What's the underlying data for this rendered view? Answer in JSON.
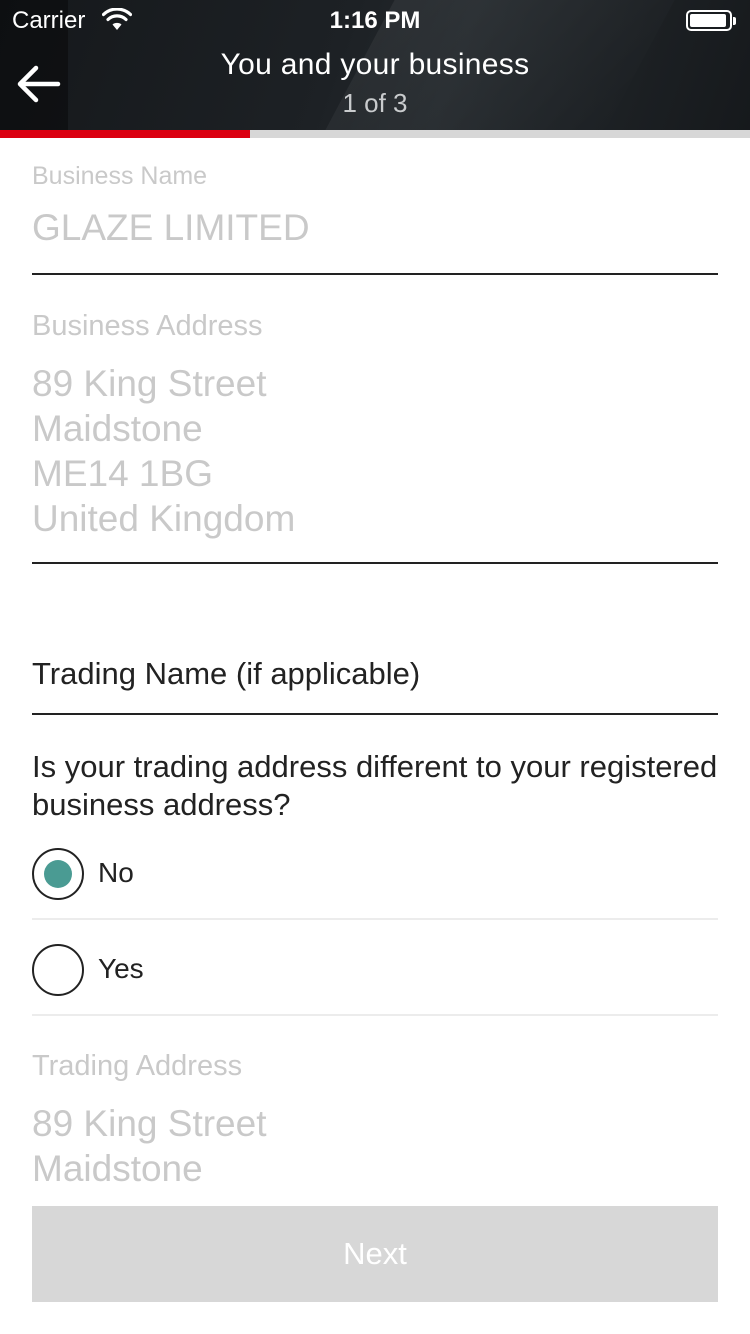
{
  "status_bar": {
    "carrier": "Carrier",
    "time": "1:16 PM"
  },
  "header": {
    "title": "You and your business",
    "step": "1 of 3",
    "progress_fraction": 0.333
  },
  "form": {
    "business_name": {
      "label": "Business Name",
      "value": "GLAZE LIMITED"
    },
    "business_address": {
      "label": "Business Address",
      "lines": [
        "89 King Street",
        "Maidstone",
        "ME14 1BG",
        "United Kingdom"
      ]
    },
    "trading_name": {
      "label": "Trading Name (if applicable)"
    },
    "trading_address_question": {
      "text": "Is your trading address different to your registered business address?",
      "options": [
        {
          "label": "No",
          "selected": true
        },
        {
          "label": "Yes",
          "selected": false
        }
      ]
    },
    "trading_address": {
      "label": "Trading Address",
      "lines": [
        "89 King Street",
        "Maidstone"
      ]
    }
  },
  "next_button": {
    "label": "Next"
  },
  "colors": {
    "accent_red": "#db0011",
    "radio_selected": "#4a9b93",
    "disabled_button": "#d7d7d7"
  }
}
